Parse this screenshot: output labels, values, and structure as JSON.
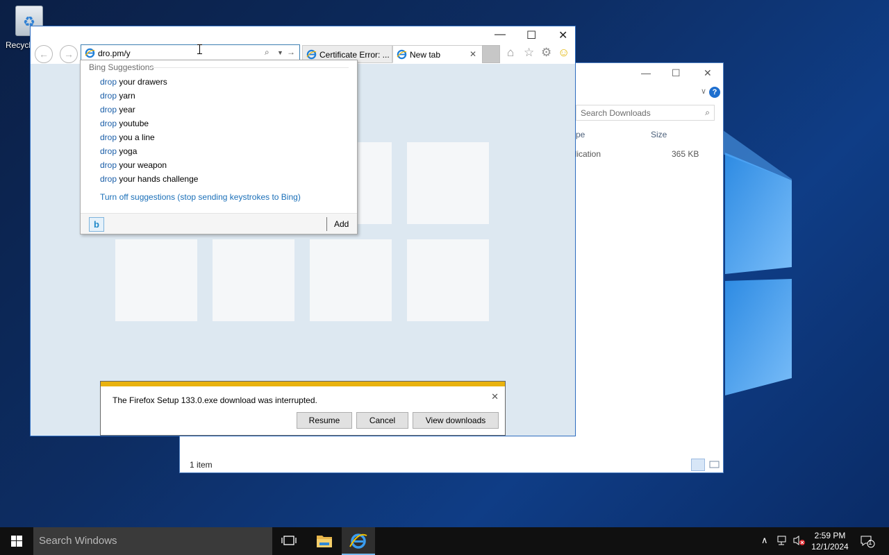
{
  "desktop": {
    "recycle_bin_label": "Recycle"
  },
  "explorer": {
    "search_placeholder": "Search Downloads",
    "col_type": "pe",
    "col_size": "Size",
    "row_type": "plication",
    "row_size": "365 KB",
    "status": "1 item",
    "help": "?"
  },
  "ie": {
    "address_value": "dro.pm/y",
    "tabs": [
      {
        "label": "Certificate Error: ..."
      },
      {
        "label": "New tab"
      }
    ]
  },
  "suggestions": {
    "header": "Bing Suggestions",
    "items": [
      {
        "match": "drop",
        "rest": " your drawers"
      },
      {
        "match": "drop",
        "rest": " yarn"
      },
      {
        "match": "drop",
        "rest": " year"
      },
      {
        "match": "drop",
        "rest": " youtube"
      },
      {
        "match": "drop",
        "rest": " you a line"
      },
      {
        "match": "drop",
        "rest": " yoga"
      },
      {
        "match": "drop",
        "rest": " your weapon"
      },
      {
        "match": "drop",
        "rest": " your hands challenge"
      }
    ],
    "turn_off": "Turn off suggestions (stop sending keystrokes to Bing)",
    "bing_logo": "b",
    "add": "Add"
  },
  "download_bar": {
    "message": "The Firefox Setup 133.0.exe download was interrupted.",
    "resume": "Resume",
    "cancel": "Cancel",
    "view": "View downloads"
  },
  "taskbar": {
    "search_placeholder": "Search Windows",
    "time": "2:59 PM",
    "date": "12/1/2024",
    "notification_count": "1"
  }
}
